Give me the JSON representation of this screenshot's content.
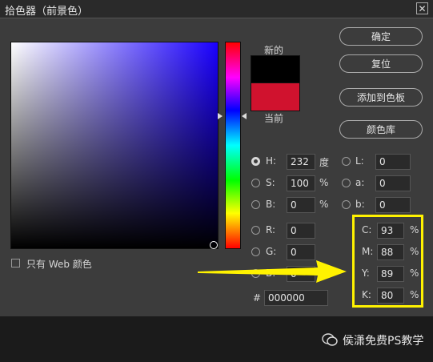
{
  "window": {
    "title": "拾色器（前景色）",
    "close_glyph": "✕"
  },
  "preview": {
    "new_label": "新的",
    "current_label": "当前",
    "new_color": "#000000",
    "current_color": "#d0122e"
  },
  "buttons": {
    "ok": "确定",
    "reset": "复位",
    "add_swatch": "添加到色板",
    "libraries": "颜色库"
  },
  "hsb": {
    "h_label": "H:",
    "h_value": "232",
    "h_unit": "度",
    "s_label": "S:",
    "s_value": "100",
    "s_unit": "%",
    "b_label": "B:",
    "b_value": "0",
    "b_unit": "%"
  },
  "rgb": {
    "r_label": "R:",
    "r_value": "0",
    "g_label": "G:",
    "g_value": "0",
    "b_label": "B:",
    "b_value": "0"
  },
  "lab": {
    "l_label": "L:",
    "l_value": "0",
    "a_label": "a:",
    "a_value": "0",
    "b_label": "b:",
    "b_value": "0"
  },
  "cmyk": {
    "c_label": "C:",
    "c_value": "93",
    "m_label": "M:",
    "m_value": "88",
    "y_label": "Y:",
    "y_value": "89",
    "k_label": "K:",
    "k_value": "80",
    "unit": "%"
  },
  "hex": {
    "label": "#",
    "value": "000000"
  },
  "web_only": {
    "label": "只有 Web 颜色"
  },
  "annotation": {
    "color": "#fff200"
  },
  "watermark": {
    "text": "侯潇免费PS教学"
  }
}
